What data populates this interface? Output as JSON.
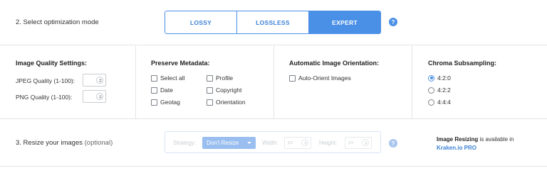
{
  "mode_section": {
    "label": "2. Select optimization mode",
    "modes": [
      "LOSSY",
      "LOSSLESS",
      "EXPERT"
    ],
    "active_mode": "EXPERT",
    "help_glyph": "?"
  },
  "quality": {
    "title": "Image Quality Settings:",
    "jpeg_label": "JPEG Quality (1-100):",
    "jpeg_value": "",
    "png_label": "PNG Quality (1-100):",
    "png_value": ""
  },
  "metadata": {
    "title": "Preserve Metadata:",
    "options": [
      "Select all",
      "Profile",
      "Date",
      "Copyright",
      "Geotag",
      "Orientation"
    ],
    "checked": []
  },
  "orientation": {
    "title": "Automatic Image Orientation:",
    "option": "Auto-Orient Images",
    "checked": false
  },
  "chroma": {
    "title": "Chroma Subsampling:",
    "options": [
      "4:2:0",
      "4:2:2",
      "4:4:4"
    ],
    "selected": "4:2:0"
  },
  "resize_section": {
    "label": "3. Resize your images",
    "optional": "(optional)",
    "strategy_label": "Strategy:",
    "strategy_value": "Don't Resize",
    "width_label": "Width:",
    "height_label": "Height:",
    "unit": "px",
    "help_glyph": "?",
    "pro_note_strong": "Image Resizing",
    "pro_note_text": " is available in",
    "pro_link": "Kraken.io PRO"
  },
  "colors": {
    "accent": "#4a90e6",
    "border": "#e1e3e6",
    "disabled_accent": "#8fb8ee"
  }
}
